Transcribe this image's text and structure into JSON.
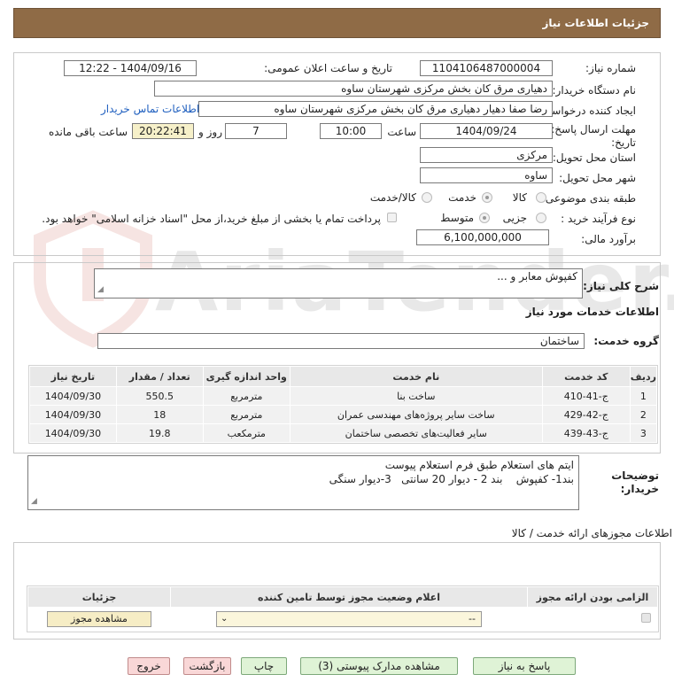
{
  "header": {
    "title": "جزئیات اطلاعات نیاز"
  },
  "form": {
    "need_number_label": "شماره نیاز:",
    "need_number": "1104106487000004",
    "announce_label": "تاریخ و ساعت اعلان عمومی:",
    "announce_value": "1404/09/16 - 12:22",
    "buyer_org_label": "نام دستگاه خریدار:",
    "buyer_org": "دهیاری مرق کان بخش مرکزی شهرستان ساوه",
    "creator_label": "ایجاد کننده درخواست:",
    "creator": "رضا صفا دهیار دهیاری مرق کان بخش مرکزی شهرستان ساوه",
    "contact_link": "اطلاعات تماس خریدار",
    "deadline_label_1": "مهلت ارسال پاسخ: تا",
    "deadline_label_2": "تاریخ:",
    "deadline_date": "1404/09/24",
    "time_label": "ساعت",
    "deadline_time": "10:00",
    "days_value": "7",
    "days_label": "روز و",
    "remaining_time": "20:22:41",
    "remaining_label": "ساعت باقی مانده",
    "province_label": "استان محل تحویل:",
    "province": "مرکزی",
    "city_label": "شهر محل تحویل:",
    "city": "ساوه",
    "category_label": "طبقه بندی موضوعی:",
    "category_options": [
      "کالا",
      "خدمت",
      "کالا/خدمت"
    ],
    "category_selected": "خدمت",
    "process_label": "نوع فرآیند خرید :",
    "process_options": [
      "جزیی",
      "متوسط"
    ],
    "process_selected": "متوسط",
    "treasury_note": "پرداخت تمام یا بخشی از مبلغ خرید،از محل \"اسناد خزانه اسلامی\" خواهد بود.",
    "budget_label": "برآورد مالی:",
    "budget": "6,100,000,000"
  },
  "need_desc": {
    "label": "شرح کلی نیاز:",
    "value": "کفپوش معابر و ..."
  },
  "services": {
    "heading": "اطلاعات خدمات مورد نیاز",
    "group_label": "گروه خدمت:",
    "group_value": "ساختمان",
    "table": {
      "headers": [
        "ردیف",
        "کد خدمت",
        "نام خدمت",
        "واحد اندازه گیری",
        "تعداد / مقدار",
        "تاریخ نیاز"
      ],
      "rows": [
        [
          "1",
          "ج-41-410",
          "ساخت بنا",
          "مترمربع",
          "550.5",
          "1404/09/30"
        ],
        [
          "2",
          "ج-42-429",
          "ساخت سایر پروژه‌های مهندسی عمران",
          "مترمربع",
          "18",
          "1404/09/30"
        ],
        [
          "3",
          "ج-43-439",
          "سایر فعالیت‌های تخصصی ساختمان",
          "مترمکعب",
          "19.8",
          "1404/09/30"
        ]
      ]
    }
  },
  "buyer_notes": {
    "label_1": "توضیحات",
    "label_2": "خریدار:",
    "line1": "ایتم های استعلام طبق فرم استعلام پیوست",
    "line2": "بند1- کفپوش    بند 2 - دیوار 20 سانتی   3-دیوار سنگی"
  },
  "permits": {
    "heading": "اطلاعات مجوزهای ارائه خدمت / کالا",
    "headers": [
      "الزامی بودن ارائه مجوز",
      "اعلام وضعیت مجوز توسط تامین کننده",
      "جزئیات"
    ],
    "select_value": "--",
    "view_button": "مشاهده مجوز"
  },
  "watermark": "AriaTender.neT",
  "buttons": {
    "reply": "پاسخ به نیاز",
    "docs": "مشاهده مدارک پیوستی (3)",
    "print": "چاپ",
    "back": "بازگشت",
    "exit": "خروج"
  }
}
